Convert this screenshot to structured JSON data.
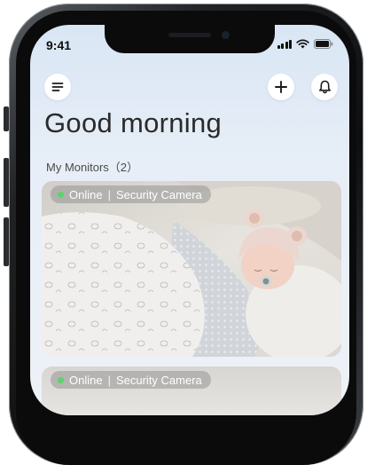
{
  "status_bar": {
    "time": "9:41",
    "icons": [
      "signal-icon",
      "wifi-icon",
      "battery-icon"
    ]
  },
  "header": {
    "menu_icon": "menu-icon",
    "add_icon": "plus-icon",
    "notification_icon": "bell-icon"
  },
  "greeting": "Good morning",
  "monitors": {
    "section_label": "My Monitors（2）",
    "items": [
      {
        "status": "Online",
        "separator": "|",
        "name": "Security Camera",
        "status_color": "#5ad46b"
      },
      {
        "status": "Online",
        "separator": "|",
        "name": "Security Camera",
        "status_color": "#5ad46b"
      }
    ]
  },
  "colors": {
    "screen_top": "#d9e6f4",
    "screen_bottom": "#eef2f7",
    "online_dot": "#5ad46b"
  }
}
